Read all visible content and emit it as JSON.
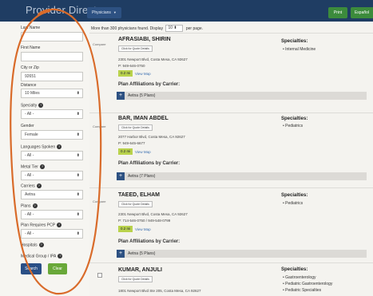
{
  "app": {
    "title": "Provider Directory",
    "tab_label": "Physicians",
    "print_label": "Print",
    "espanol_label": "Español"
  },
  "filters": {
    "last_name": {
      "label": "Last Name",
      "value": ""
    },
    "first_name": {
      "label": "First Name",
      "value": ""
    },
    "city_zip": {
      "label": "City or Zip",
      "value": "92651"
    },
    "distance": {
      "label": "Distance",
      "value": "10 Miles"
    },
    "specialty": {
      "label": "Specialty",
      "value": "- All -"
    },
    "gender": {
      "label": "Gender",
      "value": "Female"
    },
    "languages": {
      "label": "Languages Spoken",
      "value": "- All -"
    },
    "metal_tier": {
      "label": "Metal Tier",
      "value": "- All -"
    },
    "carriers": {
      "label": "Carriers",
      "value": "Aetna"
    },
    "plans": {
      "label": "Plans",
      "value": "- All -"
    },
    "plan_pcp": {
      "label": "Plan Requires PCP",
      "value": "- All -"
    },
    "hospitals": {
      "label": "Hospitals",
      "value": ""
    },
    "medical_group": {
      "label": "Medical Group / IPA"
    },
    "search_label": "Search",
    "clear_label": "Clear"
  },
  "results": {
    "found_text": "More than 300 physicians found.",
    "display_label": "Display",
    "display_value": "10",
    "per_page": "per page."
  },
  "compare_label": "Compare",
  "quote_label": "Click for Quote Details",
  "view_map_label": "View Map",
  "affiliations_title": "Plan Affiliations by Carrier:",
  "specialties_title": "Specialties:",
  "physicians": [
    {
      "name": "AFRASIABI, SHIRIN",
      "address": "2301 Newport Blvd, Costa Mesa, CA 92627",
      "phone": "P: 949-646-0750",
      "distance": "0.2 mi",
      "affiliation": "Aetna (5 Plans)",
      "specialties": [
        "Internal Medicine"
      ]
    },
    {
      "name": "BAR, IMAN ABDEL",
      "address": "2077 Harbor Blvd, Costa Mesa, CA 92627",
      "phone": "P: 949-645-6677",
      "distance": "0.2 mi",
      "affiliation": "Aetna (7 Plans)",
      "specialties": [
        "Pediatrics"
      ]
    },
    {
      "name": "TAEED, ELHAM",
      "address": "2301 Newport Blvd, Costa Mesa, CA 92627",
      "phone": "P: 714-546-0750 / 949-548-0799",
      "distance": "0.2 mi",
      "affiliation": "Aetna (5 Plans)",
      "specialties": [
        "Pediatrics"
      ]
    },
    {
      "name": "KUMAR, ANJULI",
      "address": "1801 Newport Blvd Ste 205, Costa Mesa, CA 92627",
      "specialties": [
        "Gastroenterology",
        "Pediatric Gastroenterology",
        "Pediatric Specialties"
      ]
    }
  ],
  "colors": {
    "topbar": "#1f3d63",
    "accent_green": "#3c8b3c",
    "annotation": "#d96b2a"
  }
}
